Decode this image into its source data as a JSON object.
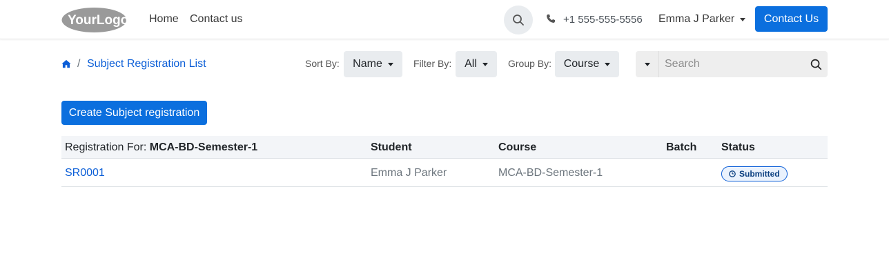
{
  "header": {
    "logo_text": "YourLogo",
    "nav": [
      {
        "label": "Home"
      },
      {
        "label": "Contact us"
      }
    ],
    "phone": "+1 555-555-5556",
    "user_name": "Emma J Parker",
    "contact_button": "Contact Us"
  },
  "toolbar": {
    "breadcrumb_current": "Subject Registration List",
    "breadcrumb_separator": "/",
    "sort_label": "Sort By:",
    "sort_value": "Name",
    "filter_label": "Filter By:",
    "filter_value": "All",
    "group_label": "Group By:",
    "group_value": "Course",
    "search_placeholder": "Search"
  },
  "actions": {
    "create_button": "Create Subject registration"
  },
  "table": {
    "group_prefix": "Registration For:",
    "group_value": "MCA-BD-Semester-1",
    "columns": [
      "Student",
      "Course",
      "Batch",
      "Status"
    ],
    "rows": [
      {
        "id": "SR0001",
        "student": "Emma J Parker",
        "course": "MCA-BD-Semester-1",
        "batch": "",
        "status": "Submitted"
      }
    ]
  },
  "colors": {
    "primary": "#0b6fde",
    "link": "#0b5ed7",
    "badge_bg": "#eaf2fd",
    "header_row_bg": "#f3f5f8"
  },
  "icons": [
    "logo-icon",
    "search-icon",
    "phone-icon",
    "home-icon",
    "caret-down-icon",
    "clock-icon"
  ]
}
